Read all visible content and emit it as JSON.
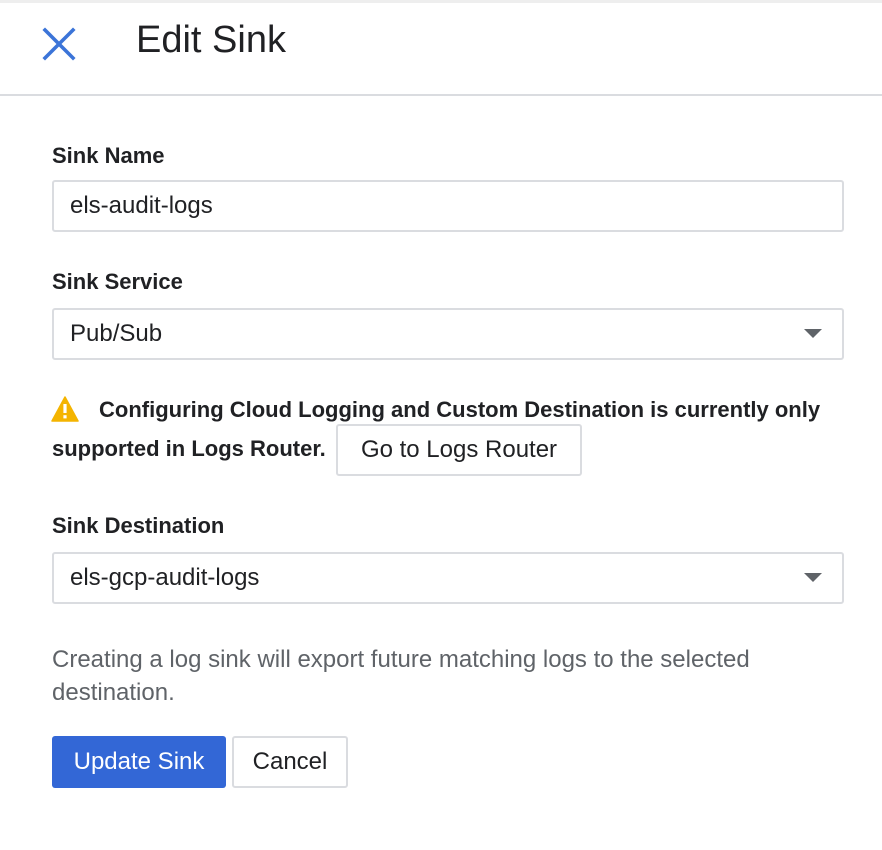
{
  "header": {
    "close_icon": "close-icon",
    "title": "Edit Sink"
  },
  "sink_name": {
    "label": "Sink Name",
    "value": "els-audit-logs"
  },
  "sink_service": {
    "label": "Sink Service",
    "selected": "Pub/Sub"
  },
  "warning": {
    "icon": "warning-icon",
    "line1": "Configuring Cloud Logging and Custom Destination is currently only",
    "line2": "supported in Logs Router.",
    "button_label": "Go to Logs Router"
  },
  "sink_destination": {
    "label": "Sink Destination",
    "selected": "els-gcp-audit-logs"
  },
  "info_text": "Creating a log sink will export future matching logs to the selected destination.",
  "actions": {
    "update_label": "Update Sink",
    "cancel_label": "Cancel"
  },
  "colors": {
    "accent": "#3367d6",
    "close_icon": "#3b74d8",
    "warning": "#f4b400",
    "border": "#dadce0",
    "muted_text": "#5f6368"
  }
}
